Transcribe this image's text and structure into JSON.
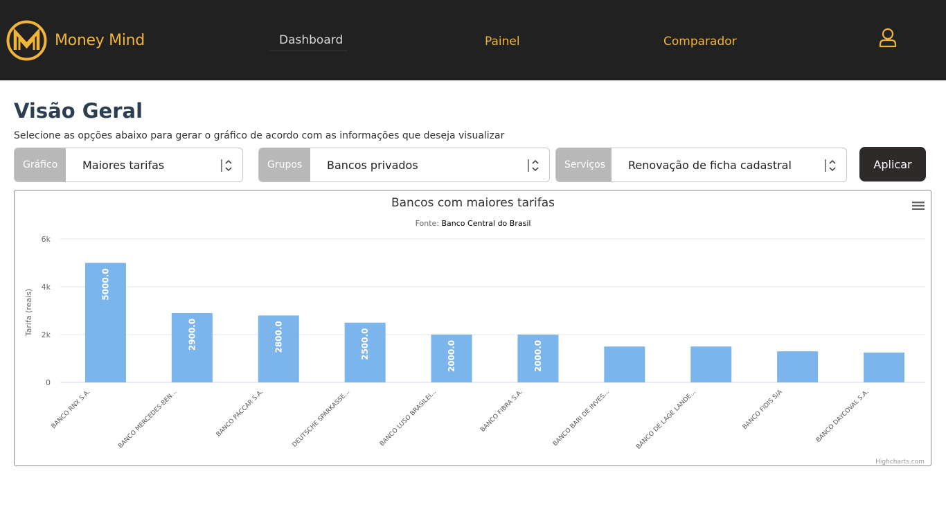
{
  "app": {
    "brand": "Money Mind",
    "colors": {
      "navbar": "#212121",
      "accent": "#f0b43a",
      "bar": "#7cb5ec",
      "button": "#2e2a2a"
    }
  },
  "nav": {
    "items": [
      {
        "label": "Dashboard"
      },
      {
        "label": "Painel"
      },
      {
        "label": "Comparador"
      }
    ],
    "user_icon": "user-icon"
  },
  "page": {
    "title": "Visão Geral",
    "subtitle": "Selecione as opções abaixo para gerar o gráfico de acordo com as informações que deseja visualizar"
  },
  "filters": {
    "grafico": {
      "label": "Gráfico",
      "value": "Maiores tarifas"
    },
    "grupos": {
      "label": "Grupos",
      "value": "Bancos privados"
    },
    "servicos": {
      "label": "Serviços",
      "value": "Renovação de ficha cadastral"
    },
    "apply_label": "Aplicar"
  },
  "chart_data": {
    "type": "bar",
    "title": "Bancos com maiores tarifas",
    "subtitle_prefix": "Fonte: ",
    "subtitle_source": "Banco Central do Brasil",
    "ylabel": "Tarifa (reais)",
    "ylim": [
      0,
      6000
    ],
    "yticks": [
      {
        "value": 0,
        "label": "0"
      },
      {
        "value": 2000,
        "label": "2k"
      },
      {
        "value": 4000,
        "label": "4k"
      },
      {
        "value": 6000,
        "label": "6k"
      }
    ],
    "categories": [
      "BANCO RNX S.A.",
      "BANCO MERCEDES-BEN...",
      "BANCO PACCAR S.A.",
      "DEUTSCHE SPARKASSE...",
      "BANCO LUSO BRASILEI...",
      "BANCO FIBRA S.A.",
      "BANCO BARI DE INVES...",
      "BANCO DE LAGE LANDE...",
      "BANCO FIDIS S/A",
      "BANCO DAYCOVAL S.A."
    ],
    "values": [
      5000,
      2900,
      2800,
      2500,
      2000,
      2000,
      1500,
      1500,
      1300,
      1250
    ],
    "data_labels": [
      "5000.0",
      "2900.0",
      "2800.0",
      "2500.0",
      "2000.0",
      "2000.0",
      "",
      "",
      "",
      ""
    ],
    "grid": true,
    "credits": "Highcharts.com"
  }
}
